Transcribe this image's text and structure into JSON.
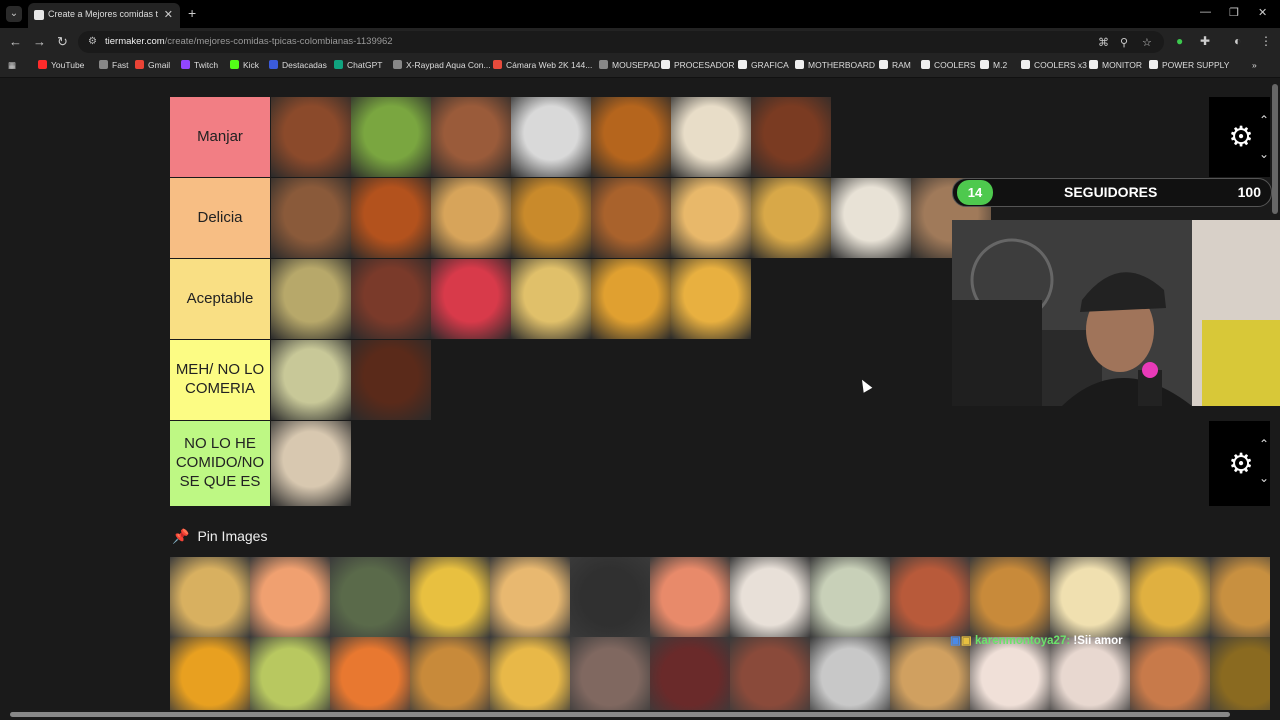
{
  "browser": {
    "tab_title": "Create a Mejores comidas típicas",
    "url_domain": "tiermaker.com",
    "url_path": "/create/mejores-comidas-tpicas-colombianas-1139962",
    "bookmarks": [
      "YouTube",
      "Fast",
      "Gmail",
      "Twitch",
      "Kick",
      "Destacadas",
      "ChatGPT",
      "X-Raypad Aqua Con...",
      "Cámara Web 2K 144...",
      "MOUSEPAD",
      "PROCESADOR",
      "GRAFICA",
      "MOTHERBOARD",
      "RAM",
      "COOLERS",
      "M.2",
      "COOLERS x3",
      "MONITOR",
      "POWER SUPPLY"
    ],
    "bookmark_colors": [
      "#ff2b2b",
      "#888888",
      "#ea4335",
      "#9146ff",
      "#53fc18",
      "#3b5bdb",
      "#10a37f",
      "#888888",
      "#e84b3c",
      "#888888",
      "#f0f0f0",
      "#f0f0f0",
      "#f0f0f0",
      "#f0f0f0",
      "#f0f0f0",
      "#f0f0f0",
      "#f0f0f0",
      "#f0f0f0",
      "#f0f0f0"
    ]
  },
  "tiers": [
    {
      "label": "Manjar",
      "color": "#f27e84",
      "items": [
        "#8b4a2b",
        "#7aa640",
        "#9a5b3a",
        "#d9d9d9",
        "#b5651d",
        "#e8ddc8",
        "#7a3b22"
      ]
    },
    {
      "label": "Delicia",
      "color": "#f7be84",
      "items": [
        "#8a5a3a",
        "#b3521d",
        "#d7a45a",
        "#c98a2b",
        "#a9622c",
        "#e8b86a",
        "#d8a848",
        "#e8e2d6",
        "#a07a5a"
      ]
    },
    {
      "label": "Aceptable",
      "color": "#f9df84",
      "items": [
        "#b7a86a",
        "#7a3a2a",
        "#d83a4a",
        "#e0c06a",
        "#e0a030",
        "#e8b040"
      ]
    },
    {
      "label": "MEH/ NO LO COMERIA",
      "color": "#fcfc84",
      "items": [
        "#c8c898",
        "#5a2a1a"
      ]
    },
    {
      "label": "NO LO HE COMIDO/NO SE QUE ES",
      "color": "#bef884",
      "items": [
        "#d8c8b0"
      ]
    }
  ],
  "pin_images": {
    "title": "Pin Images",
    "row1": [
      "#d8b060",
      "#f0a070",
      "#5a6a4a",
      "#e8c040",
      "#e8b870",
      "#303030",
      "#e88a6a",
      "#e8e0d8",
      "#c8d0b8",
      "#b85a3a",
      "#c88a3a",
      "#f0e0b0",
      "#e0b040",
      "#c89040"
    ],
    "row2": [
      "#e8a020",
      "#b8c860",
      "#e87830",
      "#c88a3a",
      "#e8b848",
      "#806860",
      "#6a2a2a",
      "#8a4a3a",
      "#c8c8c8",
      "#d0a060",
      "#f0e0d8",
      "#e8d8d0",
      "#c87a4a",
      "#8a6a20"
    ]
  },
  "stream_overlay": {
    "followers_count": "14",
    "followers_label": "SEGUIDORES",
    "followers_goal": "100"
  },
  "chat": {
    "user": "karenmontoya27:",
    "message": "!Sii amor"
  },
  "icons": {
    "gear": "gear-icon",
    "pin": "pin-icon"
  }
}
